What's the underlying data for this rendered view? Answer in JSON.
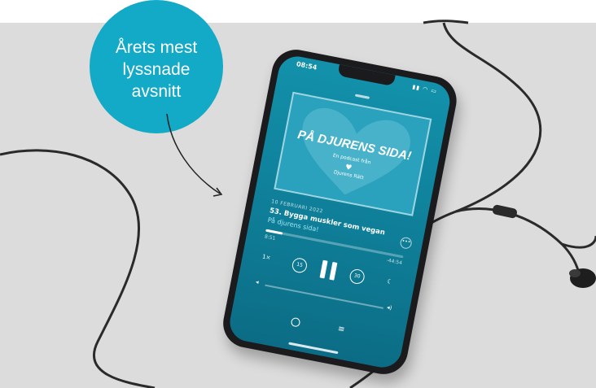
{
  "callout": {
    "line1": "Årets mest",
    "line2": "lyssnade",
    "line3": "avsnitt"
  },
  "phone": {
    "status_time": "08:54",
    "podcast_art": {
      "title": "PÅ DJURENS SIDA!",
      "subtitle": "En podcast från",
      "brand": "Djurens Rätt"
    },
    "episode": {
      "date": "10 FEBRUARI 2022",
      "title": "53. Bygga muskler som vegan",
      "show": "På djurens sida!"
    },
    "progress_fraction": 0.12,
    "elapsed": "8:51",
    "remaining": "-44:54",
    "speed": "1×",
    "skip_back": "15",
    "skip_forward": "30"
  },
  "colors": {
    "callout": "#12aac7",
    "screen": "#1391ab",
    "backdrop": "#dcdcdc",
    "phone_body": "#1b1b1d"
  }
}
